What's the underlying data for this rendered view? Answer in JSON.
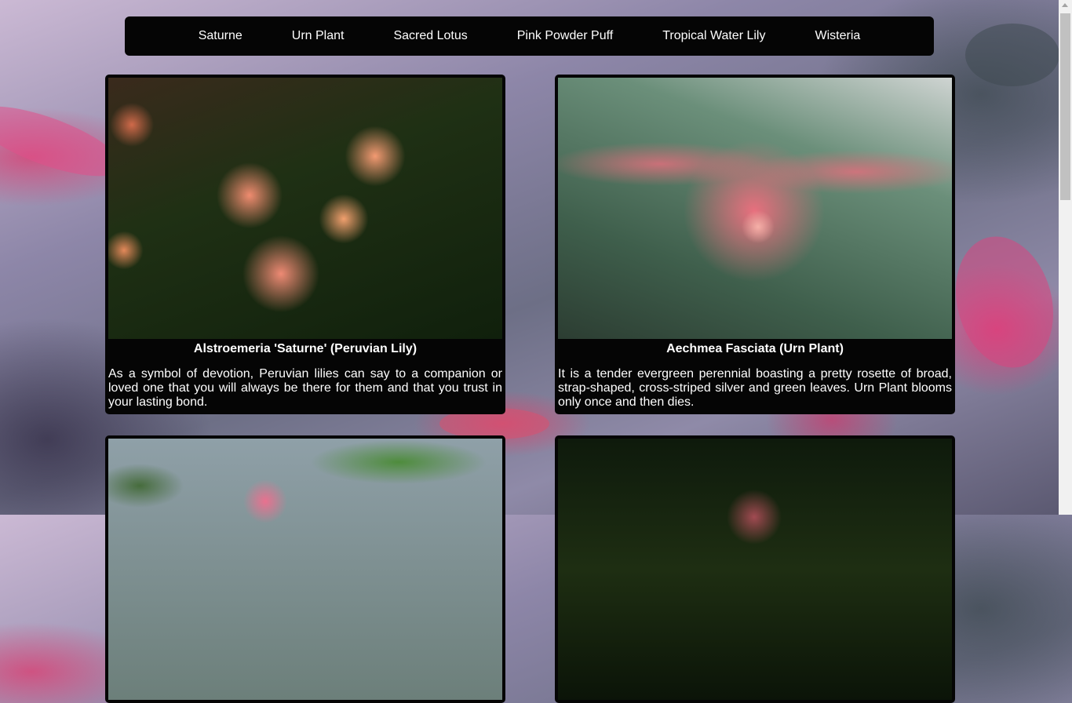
{
  "nav": {
    "items": [
      {
        "label": "Saturne"
      },
      {
        "label": "Urn Plant"
      },
      {
        "label": "Sacred Lotus"
      },
      {
        "label": "Pink Powder Puff"
      },
      {
        "label": "Tropical Water Lily"
      },
      {
        "label": "Wisteria"
      }
    ]
  },
  "cards": [
    {
      "title": "Alstroemeria 'Saturne' (Peruvian Lily)",
      "description": "As a symbol of devotion, Peruvian lilies can say to a companion or loved one that you will always be there for them and that you trust in your lasting bond."
    },
    {
      "title": "Aechmea Fasciata (Urn Plant)",
      "description": "It is a tender evergreen perennial boasting a pretty rosette of broad, strap-shaped, cross-striped silver and green leaves. Urn Plant blooms only once and then dies."
    }
  ]
}
